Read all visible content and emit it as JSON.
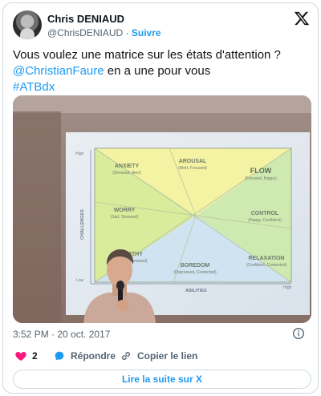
{
  "author": {
    "name": "Chris DENIAUD",
    "handle": "@ChrisDENIAUD",
    "separator": "·",
    "follow_label": "Suivre"
  },
  "tweet": {
    "line1": "Vous voulez une matrice sur les états d'attention ?",
    "mention": "@ChristianFaure",
    "line2_rest": " en a une pour vous",
    "hashtag": "#ATBdx"
  },
  "slide": {
    "y_axis_label": "CHALLENGES",
    "x_axis_label": "ABILITIES",
    "y_high": "High",
    "y_low": "Low",
    "x_high": "High",
    "regions": [
      {
        "title": "ANXIETY",
        "sub": "(Stressed, Alert)"
      },
      {
        "title": "AROUSAL",
        "sub": "(Alert, Focused)"
      },
      {
        "title": "FLOW",
        "sub": "(Focused, Happy)"
      },
      {
        "title": "WORRY",
        "sub": "(Sad, Stressed)"
      },
      {
        "title": "CONTROL",
        "sub": "(Happy, Confident)"
      },
      {
        "title": "APATHY",
        "sub": "(Sad, Depressed)"
      },
      {
        "title": "BOREDOM",
        "sub": "(Depressed, Contented)"
      },
      {
        "title": "RELAXATION",
        "sub": "(Confident, Contented)"
      }
    ]
  },
  "meta": {
    "timestamp": "3:52 PM · 20 oct. 2017"
  },
  "actions": {
    "like_count": "2",
    "reply_label": "Répondre",
    "copy_label": "Copier le lien",
    "read_more_label": "Lire la suite sur X"
  },
  "colors": {
    "link": "#1d9bf0",
    "like": "#f91880",
    "secondary_text": "#536471"
  }
}
